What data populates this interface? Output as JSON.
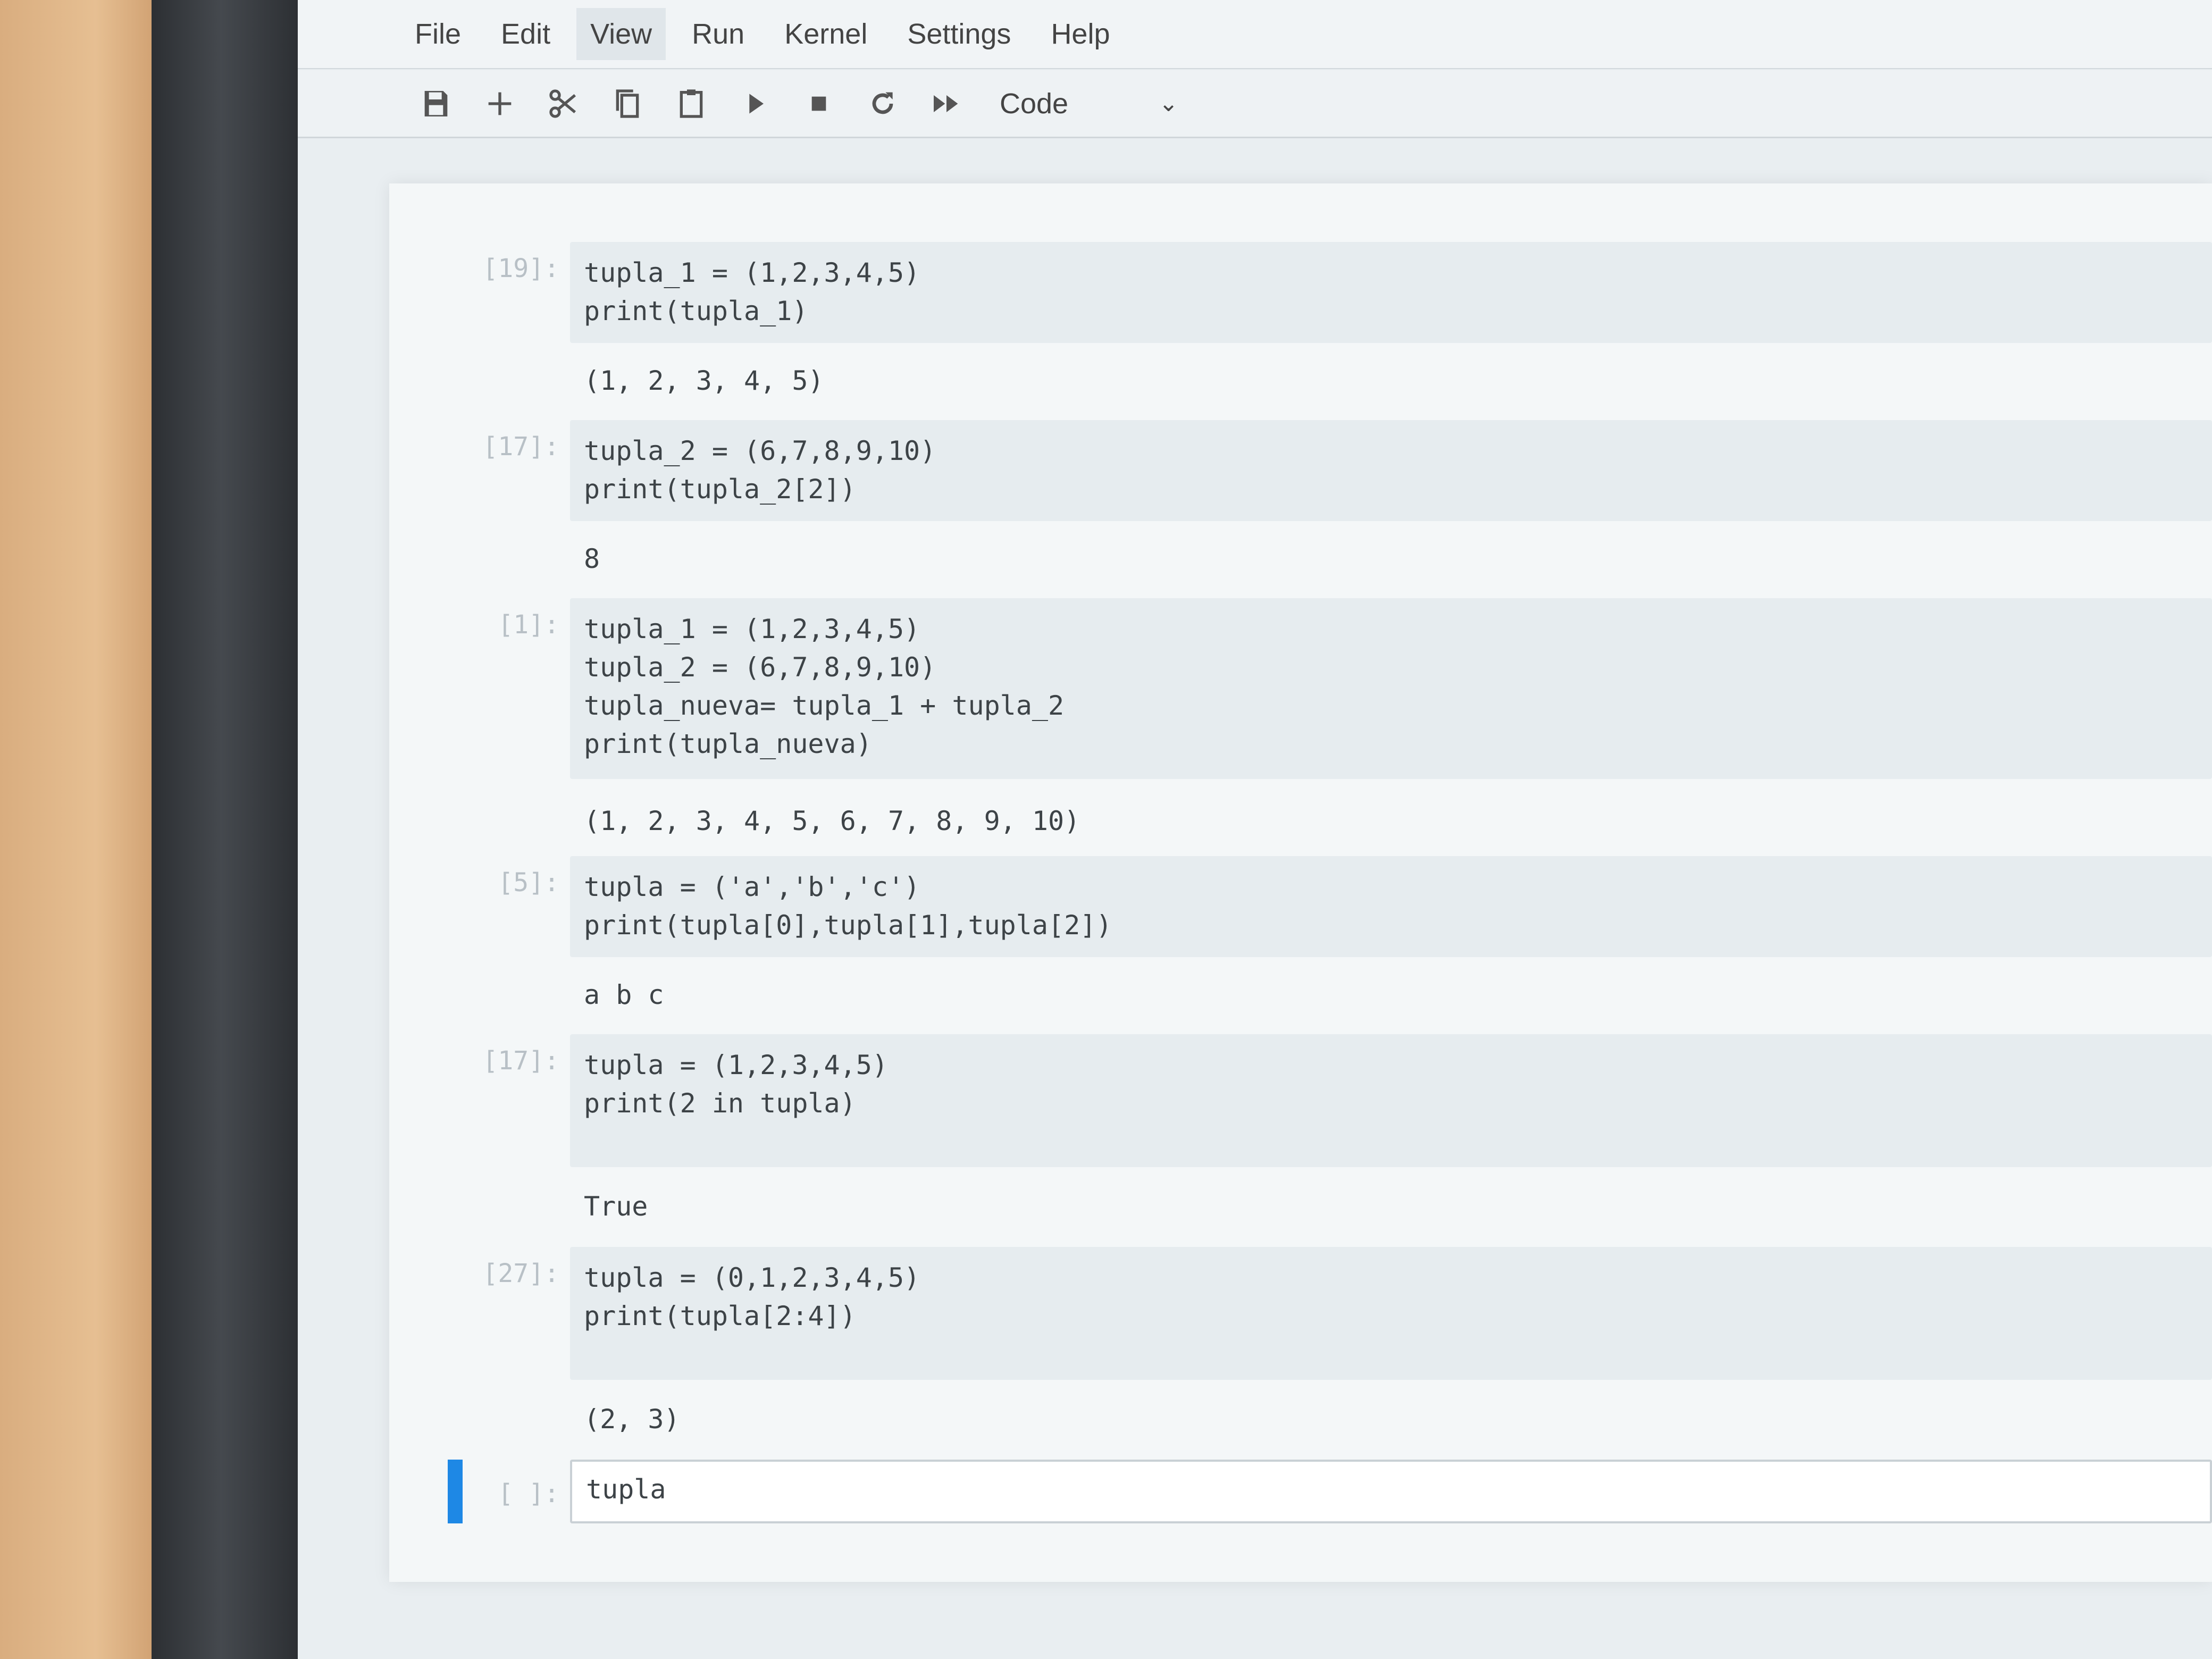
{
  "menu": [
    "File",
    "Edit",
    "View",
    "Run",
    "Kernel",
    "Settings",
    "Help"
  ],
  "toolbar": {
    "icons": [
      "save-icon",
      "add-cell-icon",
      "cut-icon",
      "copy-icon",
      "paste-icon",
      "run-icon",
      "stop-icon",
      "restart-icon",
      "fast-forward-icon"
    ],
    "cell_type": "Code"
  },
  "cells": [
    {
      "prompt": "[19]:",
      "code": [
        "tupla_1 = (1,2,3,4,5)",
        "print(tupla_1)"
      ],
      "output": "(1, 2, 3, 4, 5)"
    },
    {
      "prompt": "[17]:",
      "code": [
        "tupla_2 = (6,7,8,9,10)",
        "print(tupla_2[2])"
      ],
      "output": "8"
    },
    {
      "prompt": "[1]:",
      "code": [
        "tupla_1 = (1,2,3,4,5)",
        "tupla_2 = (6,7,8,9,10)",
        "tupla_nueva= tupla_1 + tupla_2",
        "print(tupla_nueva)"
      ],
      "output": "(1, 2, 3, 4, 5, 6, 7, 8, 9, 10)"
    },
    {
      "prompt": "[5]:",
      "code": [
        "tupla = ('a','b','c')",
        "print(tupla[0],tupla[1],tupla[2])"
      ],
      "output": "a b c"
    },
    {
      "prompt": "[17]:",
      "code": [
        "tupla = (1,2,3,4,5)",
        "print(2 in tupla)"
      ],
      "output": "True"
    },
    {
      "prompt": "[27]:",
      "code": [
        "tupla = (0,1,2,3,4,5)",
        "print(tupla[2:4])"
      ],
      "output": "(2, 3)"
    }
  ],
  "active_cell": {
    "prompt": "[ ]:",
    "code": "tupla"
  },
  "colors": {
    "accent": "#1e88e5",
    "code_bg": "#e6ecef",
    "screen_bg": "#e9eef1"
  }
}
